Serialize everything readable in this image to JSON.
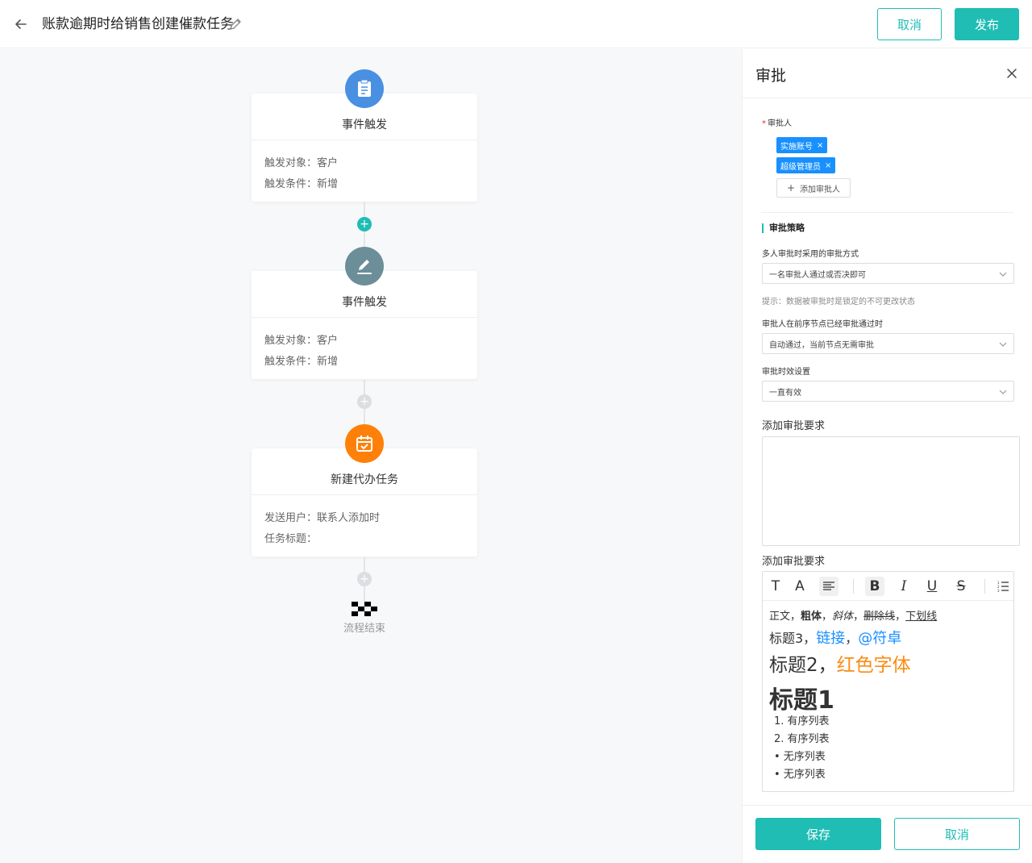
{
  "header": {
    "title": "账款逾期时给销售创建催款任务",
    "cancel_label": "取消",
    "publish_label": "发布"
  },
  "flow": {
    "nodes": [
      {
        "title": "事件触发",
        "line1": "触发对象：客户",
        "line2": "触发条件：新增",
        "icon": "clipboard-icon",
        "color": "#4a90e2"
      },
      {
        "title": "事件触发",
        "line1": "触发对象：客户",
        "line2": "触发条件：新增",
        "icon": "edit-icon",
        "color": "#6b8e99"
      },
      {
        "title": "新建代办任务",
        "line1": "发送用户：联系人添加时",
        "line2": "任务标题：",
        "icon": "calendar-check-icon",
        "color": "#ff8008"
      }
    ],
    "end_label": "流程结束"
  },
  "panel": {
    "title": "审批",
    "approver_label": "审批人",
    "approvers": [
      "实施账号",
      "超级管理员"
    ],
    "add_approver_label": "添加审批人",
    "strategy_title": "审批策略",
    "multi_mode_label": "多人审批时采用的审批方式",
    "multi_mode_value": "一名审批人通过或否决即可",
    "hint": "提示：数据被审批时是锁定的不可更改状态",
    "prev_passed_label": "审批人在前序节点已经审批通过时",
    "prev_passed_value": "自动通过，当前节点无需审批",
    "timeout_label": "审批时效设置",
    "timeout_value": "一直有效",
    "requirement_label_1": "添加审批要求",
    "requirement_label_2": "添加审批要求",
    "rte": {
      "line1": {
        "normal": "正文，",
        "bold": "粗体",
        "sep1": "，",
        "italic": "斜体",
        "sep2": "，",
        "strike": "删除线",
        "sep3": "，",
        "underline": "下划线"
      },
      "line2": {
        "h3": "标题3，",
        "link": "链接",
        "sep": "，",
        "at": "@符卓"
      },
      "line3": {
        "h2": "标题2，",
        "red": "红色字体"
      },
      "line4": {
        "h1": "标题1"
      },
      "ordered": [
        "1. 有序列表",
        "2. 有序列表"
      ],
      "unordered": [
        "• 无序列表",
        "• 无序列表"
      ]
    },
    "save_label": "保存",
    "cancel_label": "取消"
  },
  "colors": {
    "accent": "#1fbdb4",
    "tag_blue": "#1890ff",
    "link_blue": "#1890ff",
    "orange": "#fa8c16"
  }
}
